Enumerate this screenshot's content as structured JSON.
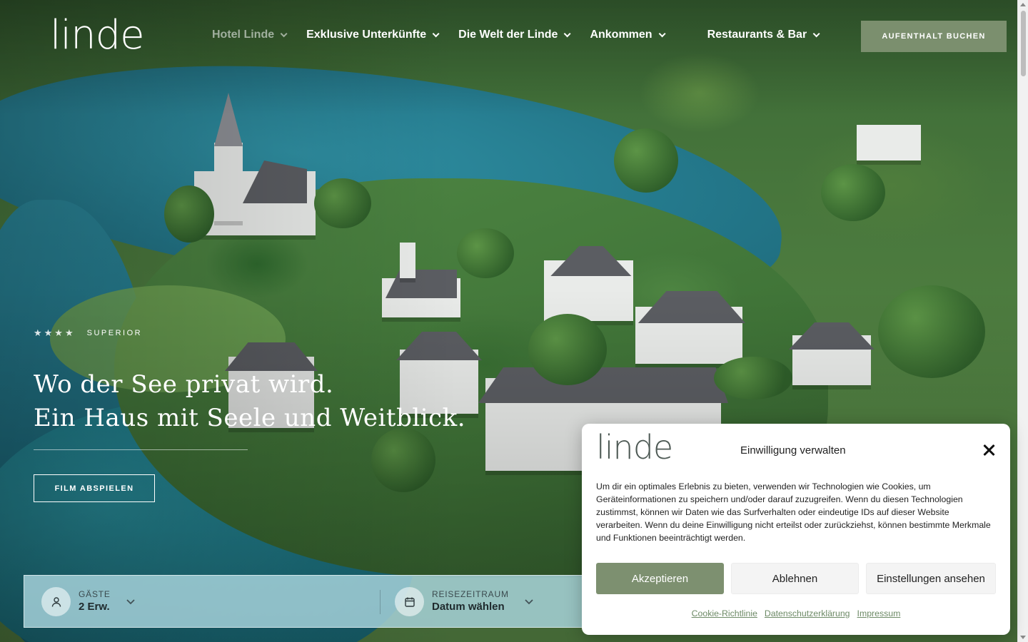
{
  "header": {
    "logo": "linde",
    "nav": [
      {
        "label": "Hotel Linde"
      },
      {
        "label": "Exklusive Unterkünfte"
      },
      {
        "label": "Die Welt der Linde"
      },
      {
        "label": "Ankommen"
      },
      {
        "label": "Restaurants & Bar"
      }
    ],
    "book_label": "AUFENTHALT BUCHEN"
  },
  "hero": {
    "stars": "★★★★",
    "rating_label": "SUPERIOR",
    "headline_line1": "Wo der See privat wird.",
    "headline_line2": "Ein Haus mit Seele und Weitblick.",
    "film_button": "FILM ABSPIELEN"
  },
  "booking": {
    "guests_label": "GÄSTE",
    "guests_value": "2 Erw.",
    "dates_label": "REISEZEITRAUM",
    "dates_value": "Datum wählen"
  },
  "cookie": {
    "logo": "linde",
    "title": "Einwilligung verwalten",
    "text": "Um dir ein optimales Erlebnis zu bieten, verwenden wir Technologien wie Cookies, um Geräteinformationen zu speichern und/oder darauf zuzugreifen. Wenn du diesen Technologien zustimmst, können wir Daten wie das Surfverhalten oder eindeutige IDs auf dieser Website verarbeiten. Wenn du deine Einwilligung nicht erteilst oder zurückziehst, können bestimmte Merkmale und Funktionen beeinträchtigt werden.",
    "accept": "Akzeptieren",
    "deny": "Ablehnen",
    "view": "Einstellungen ansehen",
    "links": [
      "Cookie-Richtlinie",
      "Datenschutzerklärung",
      "Impressum"
    ]
  },
  "colors": {
    "accent_green": "#7b8f6e",
    "link_green": "#6d8a66"
  }
}
